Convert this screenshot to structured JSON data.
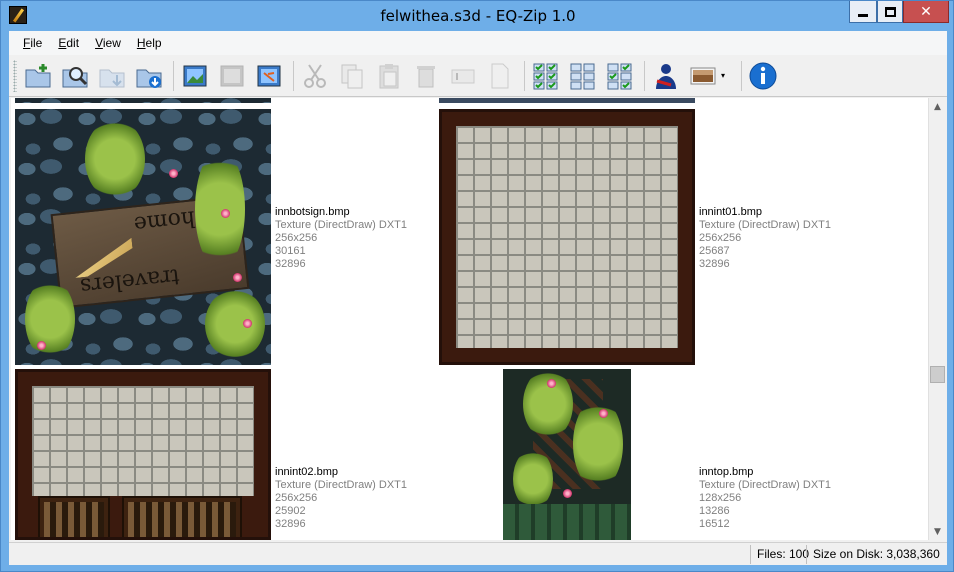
{
  "window": {
    "title": "felwithea.s3d - EQ-Zip 1.0",
    "close_glyph": "✕"
  },
  "menu": [
    {
      "key": "F",
      "rest": "ile"
    },
    {
      "key": "E",
      "rest": "dit"
    },
    {
      "key": "V",
      "rest": "iew"
    },
    {
      "key": "H",
      "rest": "elp"
    }
  ],
  "toolbar": {
    "icons": [
      "new-archive-icon",
      "open-archive-icon",
      "extract-icon",
      "save-as-icon",
      "import-image-icon",
      "export-image-icon",
      "replace-image-icon",
      "cut-icon",
      "copy-icon",
      "paste-icon",
      "delete-icon",
      "rename-icon",
      "properties-icon",
      "select-all-icon",
      "select-none-icon",
      "invert-selection-icon",
      "wizard-icon",
      "thumbnail-view-icon",
      "info-icon"
    ],
    "dropdown_glyph": "▾"
  },
  "files": [
    {
      "name": "innbotsign.bmp",
      "type": "Texture (DirectDraw) DXT1",
      "dims": "256x256",
      "size1": "30161",
      "size2": "32896"
    },
    {
      "name": "innint01.bmp",
      "type": "Texture (DirectDraw) DXT1",
      "dims": "256x256",
      "size1": "25687",
      "size2": "32896"
    },
    {
      "name": "innint02.bmp",
      "type": "Texture (DirectDraw) DXT1",
      "dims": "256x256",
      "size1": "25902",
      "size2": "32896"
    },
    {
      "name": "inntop.bmp",
      "type": "Texture (DirectDraw) DXT1",
      "dims": "128x256",
      "size1": "13286",
      "size2": "16512"
    }
  ],
  "sign": {
    "top_word": "home",
    "bottom_word": "travelers"
  },
  "scrollbar": {
    "up": "▲",
    "down": "▼"
  },
  "status": {
    "files": "Files: 100",
    "size_on_disk": "Size on Disk: 3,038,360"
  },
  "colors": {
    "title_bar": "#6eaee8",
    "close_button": "#c75050",
    "info_blue": "#1a6fd0"
  }
}
